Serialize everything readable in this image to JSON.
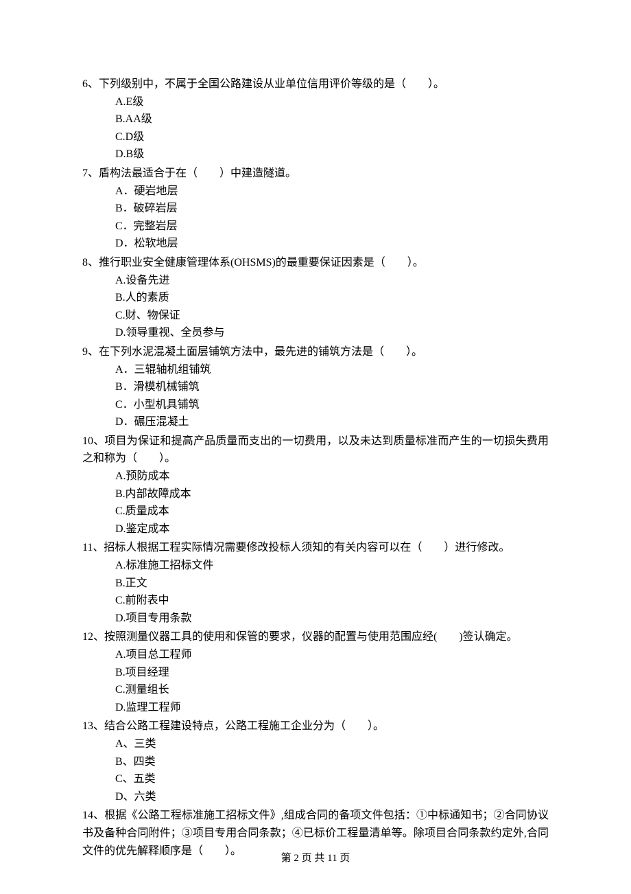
{
  "questions": [
    {
      "number": "6、",
      "stem": "下列级别中，不属于全国公路建设从业单位信用评价等级的是（　　）。",
      "options": [
        "A.E级",
        "B.AA级",
        "C.D级",
        "D.B级"
      ]
    },
    {
      "number": "7、",
      "stem": "盾构法最适合于在（　　）中建造隧道。",
      "options": [
        "A．硬岩地层",
        "B．破碎岩层",
        "C．完整岩层",
        "D．松软地层"
      ]
    },
    {
      "number": "8、",
      "stem": "推行职业安全健康管理体系(OHSMS)的最重要保证因素是（　　）。",
      "options": [
        "A.设备先进",
        "B.人的素质",
        "C.财、物保证",
        "D.领导重视、全员参与"
      ]
    },
    {
      "number": "9、",
      "stem": "在下列水泥混凝土面层铺筑方法中，最先进的铺筑方法是（　　）。",
      "options": [
        "A．三辊轴机组铺筑",
        "B．滑模机械铺筑",
        "C．小型机具铺筑",
        "D．碾压混凝土"
      ]
    },
    {
      "number": "10、",
      "stem": "项目为保证和提高产品质量而支出的一切费用，以及未达到质量标准而产生的一切损失费用之和称为（　　）。",
      "options": [
        "A.预防成本",
        "B.内部故障成本",
        "C.质量成本",
        "D.鉴定成本"
      ]
    },
    {
      "number": "11、",
      "stem": "招标人根据工程实际情况需要修改投标人须知的有关内容可以在（　　）进行修改。",
      "options": [
        "A.标准施工招标文件",
        "B.正文",
        "C.前附表中",
        "D.项目专用条款"
      ]
    },
    {
      "number": "12、",
      "stem": "按照测量仪器工具的使用和保管的要求，仪器的配置与使用范围应经(　　)签认确定。",
      "options": [
        "A.项目总工程师",
        "B.项目经理",
        "C.测量组长",
        "D.监理工程师"
      ]
    },
    {
      "number": "13、",
      "stem": "结合公路工程建设特点，公路工程施工企业分为（　　）。",
      "options": [
        "A、三类",
        "B、四类",
        "C、五类",
        "D、六类"
      ]
    },
    {
      "number": "14、",
      "stem": "根据《公路工程标准施工招标文件》,组成合同的备项文件包括：①中标通知书；②合同协议书及备种合同附件；③项目专用合同条款；④已标价工程量清单等。除项目合同条款约定外,合同文件的优先解释顺序是（　　）。",
      "options": []
    }
  ],
  "footer": "第 2 页 共 11 页"
}
